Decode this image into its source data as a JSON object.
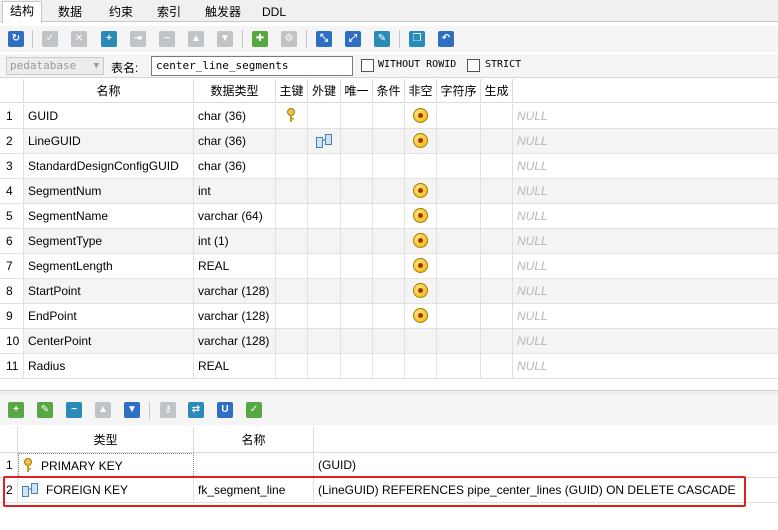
{
  "tabs": [
    "结构",
    "数据",
    "约束",
    "索引",
    "触发器",
    "DDL"
  ],
  "options": {
    "database": "pedatabase",
    "table_label": "表名:",
    "table_name": "center_line_segments",
    "without_rowid": "WITHOUT ROWID",
    "strict": "STRICT"
  },
  "columns_header": [
    "名称",
    "数据类型",
    "主键",
    "外键",
    "唯一",
    "条件",
    "非空",
    "字符序",
    "生成"
  ],
  "null_text": "NULL",
  "rows": [
    {
      "num": "1",
      "name": "GUID",
      "type": "char (36)",
      "pk": true,
      "fk": false,
      "notnull": true
    },
    {
      "num": "2",
      "name": "LineGUID",
      "type": "char (36)",
      "pk": false,
      "fk": true,
      "notnull": true
    },
    {
      "num": "3",
      "name": "StandardDesignConfigGUID",
      "type": "char (36)",
      "pk": false,
      "fk": false,
      "notnull": false
    },
    {
      "num": "4",
      "name": "SegmentNum",
      "type": "int",
      "pk": false,
      "fk": false,
      "notnull": true
    },
    {
      "num": "5",
      "name": "SegmentName",
      "type": "varchar (64)",
      "pk": false,
      "fk": false,
      "notnull": true
    },
    {
      "num": "6",
      "name": "SegmentType",
      "type": "int (1)",
      "pk": false,
      "fk": false,
      "notnull": true
    },
    {
      "num": "7",
      "name": "SegmentLength",
      "type": "REAL",
      "pk": false,
      "fk": false,
      "notnull": true
    },
    {
      "num": "8",
      "name": "StartPoint",
      "type": "varchar (128)",
      "pk": false,
      "fk": false,
      "notnull": true
    },
    {
      "num": "9",
      "name": "EndPoint",
      "type": "varchar (128)",
      "pk": false,
      "fk": false,
      "notnull": true
    },
    {
      "num": "10",
      "name": "CenterPoint",
      "type": "varchar (128)",
      "pk": false,
      "fk": false,
      "notnull": false
    },
    {
      "num": "11",
      "name": "Radius",
      "type": "REAL",
      "pk": false,
      "fk": false,
      "notnull": false
    }
  ],
  "keys_header": [
    "类型",
    "名称"
  ],
  "keys": [
    {
      "num": "1",
      "type": "PRIMARY KEY",
      "name": "",
      "definition": "(GUID)"
    },
    {
      "num": "2",
      "type": "FOREIGN KEY",
      "name": "fk_segment_line",
      "definition": "(LineGUID) REFERENCES pipe_center_lines (GUID) ON DELETE CASCADE"
    }
  ]
}
